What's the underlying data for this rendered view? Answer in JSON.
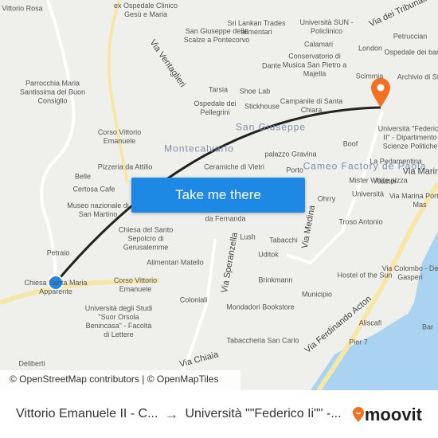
{
  "map": {
    "labels": [
      "Vittorio Rosa",
      "ex Ospedale Clinico Gesù e Maria",
      "Via Ventaglieri",
      "Sri Lankan Trades alimentari",
      "Università SUN - Policlinico",
      "Via dei Tribunali",
      "Petruccian",
      "London",
      "Ospedale dei bambol",
      "Calamari",
      "San Giuseppe delle Scalze a Pontecorvo",
      "Dante",
      "Conservatorio di Musica San Pietro a Majella",
      "Scimmia",
      "Archivio di St",
      "Parrocchia Maria Santissima del Buon Consiglio",
      "Tarsia",
      "Shoe Lab",
      "Ospedale dei Pellegrini",
      "Stickhouse",
      "Campanile di Santa Chiara",
      "Università \"Federico II\" - Dipartimento Scienze Politiche",
      "San Giuseppe",
      "Corso Vittorio Emanuele",
      "Montecalvario",
      "palazzo Gravina",
      "Boof",
      "Cameo Factory de Paola",
      "La Pedamentina",
      "Pizzeria da Attilio",
      "Ceramiche di Vietri",
      "Porto",
      "Alastor",
      "Belle",
      "Certosa Cafe",
      "Mister White pizza",
      "Università",
      "Via Marina",
      "Museo nazionale di San Martino",
      "Ohrry",
      "Via Marina Porta di Mas",
      "da Fernanda",
      "Troso Antonio",
      "Chiesa del Santo Sepolcro di Gerusalemme",
      "Lush",
      "Tabacchi",
      "Via Medina",
      "Petraio",
      "Via Speranzella",
      "Alimentari Matello",
      "Uditok",
      "Via Colombo - De Gasperi",
      "Chiesa Santa Maria Apparente",
      "Corso Vittorio Emanuele",
      "Brinkmann",
      "Hostel of the Sun",
      "Coloniali",
      "Municipio",
      "Mondadori Bookstore",
      "Università degli Studi \"Suor Orsola Benincasa\" - Facoltà di Lettere",
      "Via Ferdinando Acton",
      "Aliscafi",
      "Bar",
      "Tabaccheria San Carlo",
      "Pier 7",
      "Via Chiaia",
      "Deliberti"
    ],
    "button_label": "Take me there",
    "attribution": "© OpenStreetMap contributors | © OpenMapTiles",
    "route_color": "#222222",
    "origin_color": "#1e88e5",
    "destination_color": "#f36f21"
  },
  "footer": {
    "origin": "Vittorio Emanuele II - C...",
    "arrow": "→",
    "destination": "Università \"\"Federico Ii\"\" -...",
    "brand": "moovit",
    "brand_color": "#f36f21"
  }
}
